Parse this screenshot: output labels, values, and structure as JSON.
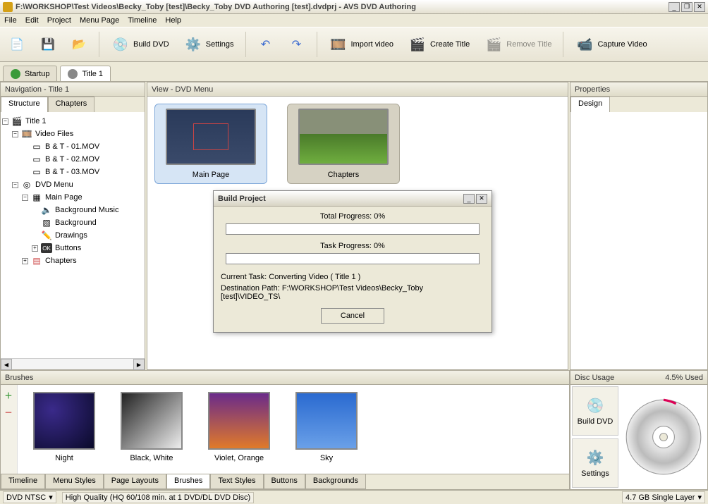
{
  "titlebar": {
    "path": "F:\\WORKSHOP\\Test Videos\\Becky_Toby [test]\\Becky_Toby DVD Authoring [test].dvdprj - AVS DVD Authoring"
  },
  "menu": {
    "file": "File",
    "edit": "Edit",
    "project": "Project",
    "menupage": "Menu Page",
    "timeline": "Timeline",
    "help": "Help"
  },
  "toolbar": {
    "build": "Build DVD",
    "settings": "Settings",
    "import": "Import video",
    "createtitle": "Create Title",
    "removetitle": "Remove Title",
    "capture": "Capture Video"
  },
  "doctabs": {
    "startup": "Startup",
    "title1": "Title 1"
  },
  "nav": {
    "header": "Navigation - Title 1",
    "tab_structure": "Structure",
    "tab_chapters": "Chapters",
    "title": "Title 1",
    "videofiles": "Video Files",
    "v1": "B & T - 01.MOV",
    "v2": "B & T - 02.MOV",
    "v3": "B & T - 03.MOV",
    "dvdmenu": "DVD Menu",
    "mainpage": "Main Page",
    "bgmusic": "Background Music",
    "background": "Background",
    "drawings": "Drawings",
    "buttons": "Buttons",
    "chapters": "Chapters"
  },
  "view": {
    "header": "View - DVD Menu",
    "mainpage_cap": "Main Page",
    "chapters_cap": "Chapters"
  },
  "props": {
    "header": "Properties",
    "tab_design": "Design"
  },
  "dialog": {
    "title": "Build Project",
    "total": "Total Progress: 0%",
    "task": "Task Progress: 0%",
    "current": "Current Task: Converting Video ( Title 1 )",
    "dest": "Destination Path: F:\\WORKSHOP\\Test Videos\\Becky_Toby [test]\\VIDEO_TS\\",
    "cancel": "Cancel"
  },
  "brushes": {
    "header": "Brushes",
    "night": "Night",
    "bw": "Black, White",
    "vo": "Violet, Orange",
    "sky": "Sky",
    "tab_timeline": "Timeline",
    "tab_menustyles": "Menu Styles",
    "tab_pagelayouts": "Page Layouts",
    "tab_brushes": "Brushes",
    "tab_textstyles": "Text  Styles",
    "tab_buttons": "Buttons",
    "tab_backgrounds": "Backgrounds"
  },
  "usage": {
    "header": "Disc Usage",
    "pct": "4.5% Used",
    "build": "Build DVD",
    "settings": "Settings"
  },
  "status": {
    "left1": "DVD NTSC",
    "left2": "High Quality (HQ 60/108 min. at 1 DVD/DL DVD Disc)",
    "right": "4.7 GB Single Layer"
  }
}
